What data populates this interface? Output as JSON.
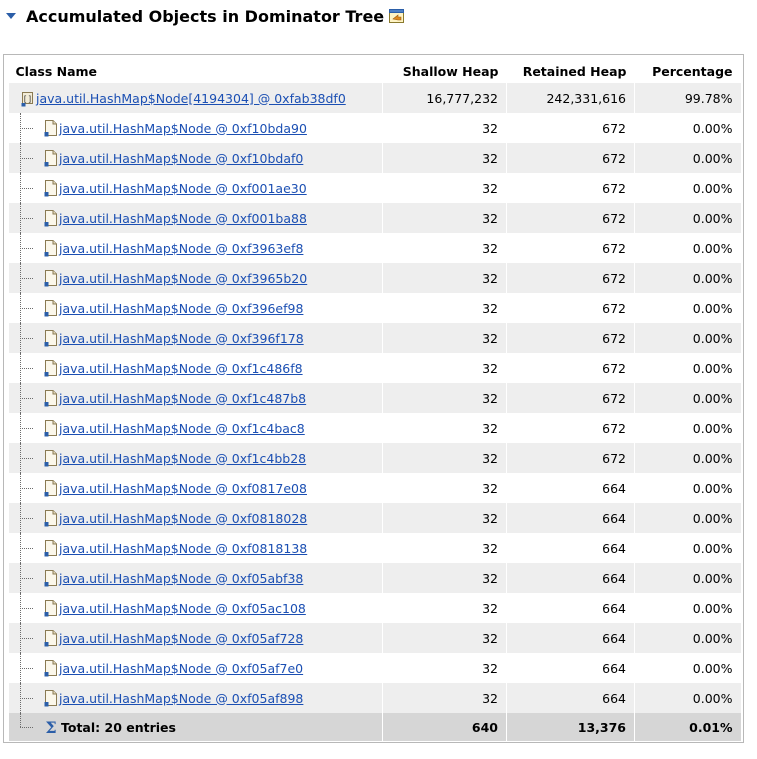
{
  "section": {
    "title": "Accumulated Objects in Dominator Tree"
  },
  "columns": {
    "class_name": "Class Name",
    "shallow_heap": "Shallow Heap",
    "retained_heap": "Retained Heap",
    "percentage": "Percentage"
  },
  "root": {
    "name": "java.util.HashMap$Node[4194304] @ 0xfab38df0",
    "shallow": "16,777,232",
    "retained": "242,331,616",
    "percentage": "99.78%"
  },
  "rows": [
    {
      "name": "java.util.HashMap$Node @ 0xf10bda90",
      "shallow": "32",
      "retained": "672",
      "percentage": "0.00%"
    },
    {
      "name": "java.util.HashMap$Node @ 0xf10bdaf0",
      "shallow": "32",
      "retained": "672",
      "percentage": "0.00%"
    },
    {
      "name": "java.util.HashMap$Node @ 0xf001ae30",
      "shallow": "32",
      "retained": "672",
      "percentage": "0.00%"
    },
    {
      "name": "java.util.HashMap$Node @ 0xf001ba88",
      "shallow": "32",
      "retained": "672",
      "percentage": "0.00%"
    },
    {
      "name": "java.util.HashMap$Node @ 0xf3963ef8",
      "shallow": "32",
      "retained": "672",
      "percentage": "0.00%"
    },
    {
      "name": "java.util.HashMap$Node @ 0xf3965b20",
      "shallow": "32",
      "retained": "672",
      "percentage": "0.00%"
    },
    {
      "name": "java.util.HashMap$Node @ 0xf396ef98",
      "shallow": "32",
      "retained": "672",
      "percentage": "0.00%"
    },
    {
      "name": "java.util.HashMap$Node @ 0xf396f178",
      "shallow": "32",
      "retained": "672",
      "percentage": "0.00%"
    },
    {
      "name": "java.util.HashMap$Node @ 0xf1c486f8",
      "shallow": "32",
      "retained": "672",
      "percentage": "0.00%"
    },
    {
      "name": "java.util.HashMap$Node @ 0xf1c487b8",
      "shallow": "32",
      "retained": "672",
      "percentage": "0.00%"
    },
    {
      "name": "java.util.HashMap$Node @ 0xf1c4bac8",
      "shallow": "32",
      "retained": "672",
      "percentage": "0.00%"
    },
    {
      "name": "java.util.HashMap$Node @ 0xf1c4bb28",
      "shallow": "32",
      "retained": "672",
      "percentage": "0.00%"
    },
    {
      "name": "java.util.HashMap$Node @ 0xf0817e08",
      "shallow": "32",
      "retained": "664",
      "percentage": "0.00%"
    },
    {
      "name": "java.util.HashMap$Node @ 0xf0818028",
      "shallow": "32",
      "retained": "664",
      "percentage": "0.00%"
    },
    {
      "name": "java.util.HashMap$Node @ 0xf0818138",
      "shallow": "32",
      "retained": "664",
      "percentage": "0.00%"
    },
    {
      "name": "java.util.HashMap$Node @ 0xf05abf38",
      "shallow": "32",
      "retained": "664",
      "percentage": "0.00%"
    },
    {
      "name": "java.util.HashMap$Node @ 0xf05ac108",
      "shallow": "32",
      "retained": "664",
      "percentage": "0.00%"
    },
    {
      "name": "java.util.HashMap$Node @ 0xf05af728",
      "shallow": "32",
      "retained": "664",
      "percentage": "0.00%"
    },
    {
      "name": "java.util.HashMap$Node @ 0xf05af7e0",
      "shallow": "32",
      "retained": "664",
      "percentage": "0.00%"
    },
    {
      "name": "java.util.HashMap$Node @ 0xf05af898",
      "shallow": "32",
      "retained": "664",
      "percentage": "0.00%"
    }
  ],
  "total": {
    "label": "Total: 20 entries",
    "shallow": "640",
    "retained": "13,376",
    "percentage": "0.01%"
  },
  "icons": {
    "toggle": "triangle-down-icon",
    "open": "open-in-view-icon",
    "array": "object-array-icon",
    "object": "object-instance-icon",
    "sum": "sigma-sum-icon"
  },
  "colors": {
    "link": "#1b4fb3",
    "row_alt": "#eeeeee",
    "total_row": "#d6d6d6",
    "toggle": "#2b5ea8"
  }
}
